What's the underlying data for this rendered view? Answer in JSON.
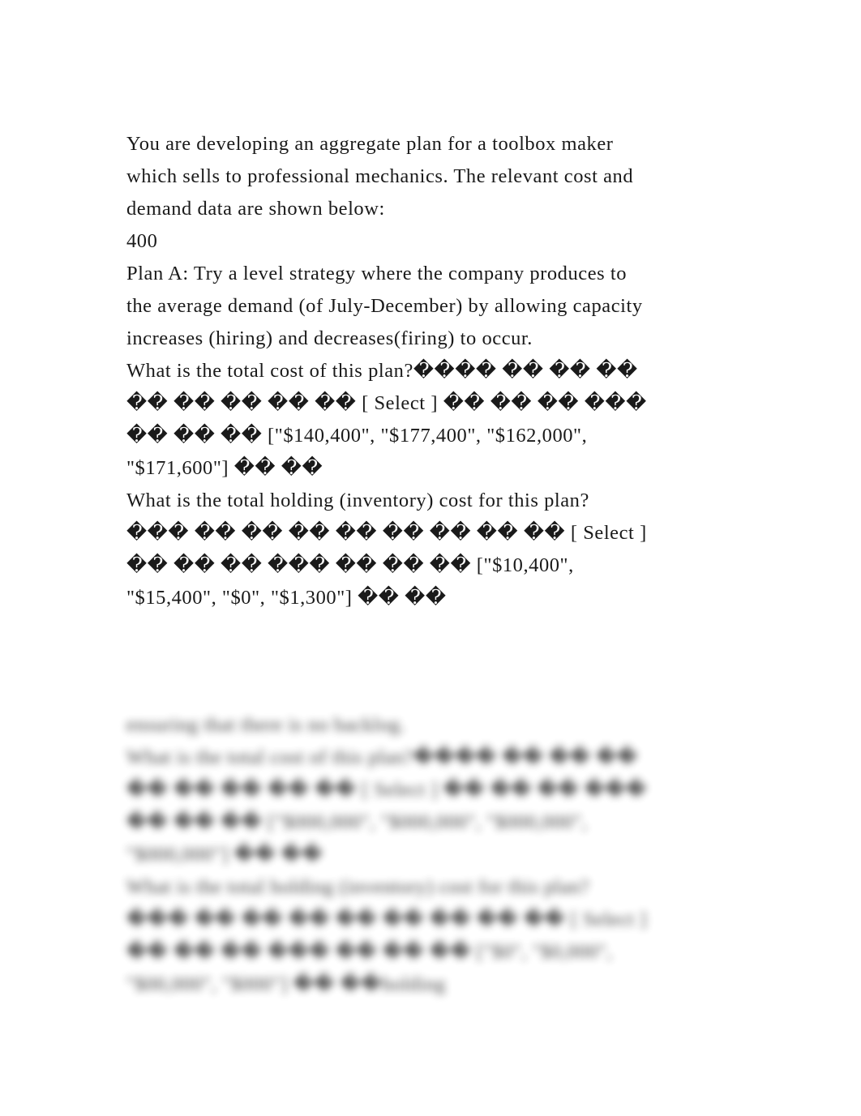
{
  "document": {
    "intro_lines": [
      "You are developing an aggregate plan for a toolbox maker",
      "which sells to professional mechanics. The relevant cost and",
      "demand data are shown below:",
      "400"
    ],
    "plan_a_lines": [
      "Plan A: Try a level strategy where the company produces to",
      "the average demand (of July-December) by allowing capacity",
      "increases (hiring) and decreases(firing) to occur."
    ],
    "question1_lines": [
      "What is the total cost of this plan?���� �� �� ��",
      "�� �� �� �� �� [ Select ] �� �� �� ���",
      "�� �� �� [\"$140,400\", \"$177,400\", \"$162,000\",",
      "\"$171,600\"] �� ��"
    ],
    "question1_options": [
      "$140,400",
      "$177,400",
      "$162,000",
      "$171,600"
    ],
    "question1_select_label": "[ Select ]",
    "question2_lines": [
      "What is the total holding (inventory) cost for this plan?",
      "��� �� �� �� �� �� �� �� �� [ Select ]",
      "�� �� �� ��� �� �� �� [\"$10,400\",",
      "\"$15,400\", \"$0\", \"$1,300\"] �� ��"
    ],
    "question2_options": [
      "$10,400",
      "$15,400",
      "$0",
      "$1,300"
    ],
    "question2_select_label": "[ Select ]"
  },
  "blurred_section": {
    "lines": [
      "ensuring that there is no backlog.",
      "What is the total cost of this plan?���� �� �� ��",
      "�� �� �� �� �� [ Select ] �� �� �� ���",
      "�� �� �� [\"$000,000\", \"$000,000\", \"$000,000\",",
      "\"$000,000\"] �� ��",
      "What is the total holding (inventory) cost for this plan?",
      "��� �� �� �� �� �� �� �� �� [ Select ]",
      "�� �� �� ��� �� �� �� [\"$0\", \"$0,000\",",
      "\"$00,000\", \"$000\"] �� ��holding"
    ]
  }
}
